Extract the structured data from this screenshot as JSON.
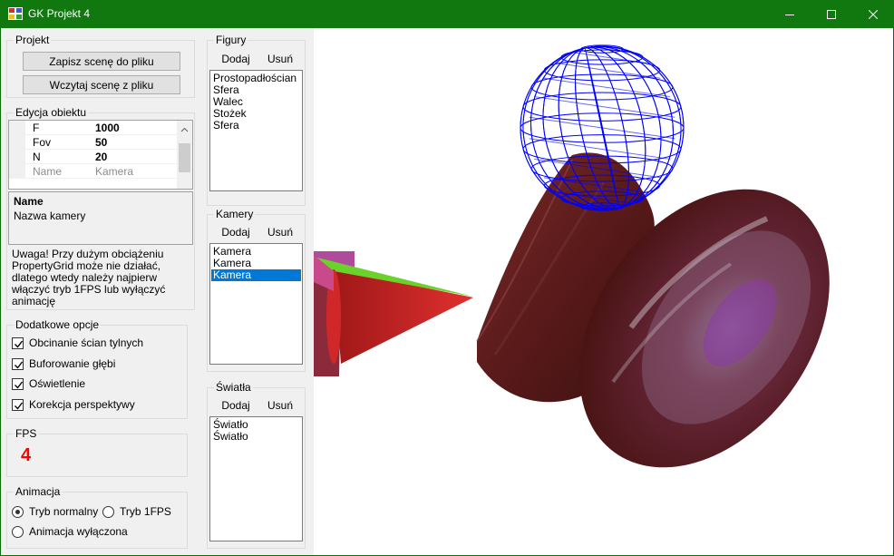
{
  "window": {
    "title": "GK Projekt 4"
  },
  "projekt": {
    "label": "Projekt",
    "save_button": "Zapisz scenę do pliku",
    "load_button": "Wczytaj scenę z pliku"
  },
  "edycja": {
    "label": "Edycja obiektu",
    "properties": [
      {
        "name": "F",
        "value": "1000",
        "readonly": false
      },
      {
        "name": "Fov",
        "value": "50",
        "readonly": false
      },
      {
        "name": "N",
        "value": "20",
        "readonly": false
      },
      {
        "name": "Name",
        "value": "Kamera",
        "readonly": true
      }
    ],
    "description_title": "Name",
    "description_text": "Nazwa kamery",
    "warning": "Uwaga! Przy dużym obciążeniu PropertyGrid może nie działać, dlatego wtedy należy najpierw włączyć tryb 1FPS lub wyłączyć animację"
  },
  "opcje": {
    "label": "Dodatkowe opcje",
    "items": [
      {
        "label": "Obcinanie ścian tylnych",
        "checked": true
      },
      {
        "label": "Buforowanie głębi",
        "checked": true
      },
      {
        "label": "Oświetlenie",
        "checked": true
      },
      {
        "label": "Korekcja perspektywy",
        "checked": true
      }
    ]
  },
  "fps": {
    "label": "FPS",
    "value": "4",
    "color": "#ff0000"
  },
  "animacja": {
    "label": "Animacja",
    "normal": "Tryb normalny",
    "one_fps": "Tryb 1FPS",
    "off": "Animacja wyłączona",
    "selected": "normal"
  },
  "figury": {
    "label": "Figury",
    "add": "Dodaj",
    "remove": "Usuń",
    "items": [
      "Prostopadłościan",
      "Sfera",
      "Walec",
      "Stożek",
      "Sfera"
    ]
  },
  "kamery": {
    "label": "Kamery",
    "add": "Dodaj",
    "remove": "Usuń",
    "items": [
      "Kamera",
      "Kamera",
      "Kamera"
    ],
    "selected_index": 2
  },
  "swiatla": {
    "label": "Światła",
    "add": "Dodaj",
    "remove": "Usuń",
    "items": [
      "Światło",
      "Światło"
    ]
  },
  "colors": {
    "titlebar": "#11780f",
    "selection": "#0078d7",
    "wire_sphere": "#0000ff"
  }
}
